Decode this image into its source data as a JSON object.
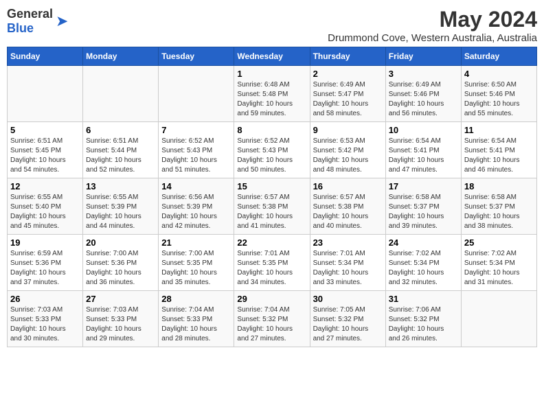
{
  "logo": {
    "general": "General",
    "blue": "Blue"
  },
  "title": "May 2024",
  "subtitle": "Drummond Cove, Western Australia, Australia",
  "days_of_week": [
    "Sunday",
    "Monday",
    "Tuesday",
    "Wednesday",
    "Thursday",
    "Friday",
    "Saturday"
  ],
  "weeks": [
    [
      {
        "day": "",
        "info": ""
      },
      {
        "day": "",
        "info": ""
      },
      {
        "day": "",
        "info": ""
      },
      {
        "day": "1",
        "info": "Sunrise: 6:48 AM\nSunset: 5:48 PM\nDaylight: 10 hours\nand 59 minutes."
      },
      {
        "day": "2",
        "info": "Sunrise: 6:49 AM\nSunset: 5:47 PM\nDaylight: 10 hours\nand 58 minutes."
      },
      {
        "day": "3",
        "info": "Sunrise: 6:49 AM\nSunset: 5:46 PM\nDaylight: 10 hours\nand 56 minutes."
      },
      {
        "day": "4",
        "info": "Sunrise: 6:50 AM\nSunset: 5:46 PM\nDaylight: 10 hours\nand 55 minutes."
      }
    ],
    [
      {
        "day": "5",
        "info": "Sunrise: 6:51 AM\nSunset: 5:45 PM\nDaylight: 10 hours\nand 54 minutes."
      },
      {
        "day": "6",
        "info": "Sunrise: 6:51 AM\nSunset: 5:44 PM\nDaylight: 10 hours\nand 52 minutes."
      },
      {
        "day": "7",
        "info": "Sunrise: 6:52 AM\nSunset: 5:43 PM\nDaylight: 10 hours\nand 51 minutes."
      },
      {
        "day": "8",
        "info": "Sunrise: 6:52 AM\nSunset: 5:43 PM\nDaylight: 10 hours\nand 50 minutes."
      },
      {
        "day": "9",
        "info": "Sunrise: 6:53 AM\nSunset: 5:42 PM\nDaylight: 10 hours\nand 48 minutes."
      },
      {
        "day": "10",
        "info": "Sunrise: 6:54 AM\nSunset: 5:41 PM\nDaylight: 10 hours\nand 47 minutes."
      },
      {
        "day": "11",
        "info": "Sunrise: 6:54 AM\nSunset: 5:41 PM\nDaylight: 10 hours\nand 46 minutes."
      }
    ],
    [
      {
        "day": "12",
        "info": "Sunrise: 6:55 AM\nSunset: 5:40 PM\nDaylight: 10 hours\nand 45 minutes."
      },
      {
        "day": "13",
        "info": "Sunrise: 6:55 AM\nSunset: 5:39 PM\nDaylight: 10 hours\nand 44 minutes."
      },
      {
        "day": "14",
        "info": "Sunrise: 6:56 AM\nSunset: 5:39 PM\nDaylight: 10 hours\nand 42 minutes."
      },
      {
        "day": "15",
        "info": "Sunrise: 6:57 AM\nSunset: 5:38 PM\nDaylight: 10 hours\nand 41 minutes."
      },
      {
        "day": "16",
        "info": "Sunrise: 6:57 AM\nSunset: 5:38 PM\nDaylight: 10 hours\nand 40 minutes."
      },
      {
        "day": "17",
        "info": "Sunrise: 6:58 AM\nSunset: 5:37 PM\nDaylight: 10 hours\nand 39 minutes."
      },
      {
        "day": "18",
        "info": "Sunrise: 6:58 AM\nSunset: 5:37 PM\nDaylight: 10 hours\nand 38 minutes."
      }
    ],
    [
      {
        "day": "19",
        "info": "Sunrise: 6:59 AM\nSunset: 5:36 PM\nDaylight: 10 hours\nand 37 minutes."
      },
      {
        "day": "20",
        "info": "Sunrise: 7:00 AM\nSunset: 5:36 PM\nDaylight: 10 hours\nand 36 minutes."
      },
      {
        "day": "21",
        "info": "Sunrise: 7:00 AM\nSunset: 5:35 PM\nDaylight: 10 hours\nand 35 minutes."
      },
      {
        "day": "22",
        "info": "Sunrise: 7:01 AM\nSunset: 5:35 PM\nDaylight: 10 hours\nand 34 minutes."
      },
      {
        "day": "23",
        "info": "Sunrise: 7:01 AM\nSunset: 5:34 PM\nDaylight: 10 hours\nand 33 minutes."
      },
      {
        "day": "24",
        "info": "Sunrise: 7:02 AM\nSunset: 5:34 PM\nDaylight: 10 hours\nand 32 minutes."
      },
      {
        "day": "25",
        "info": "Sunrise: 7:02 AM\nSunset: 5:34 PM\nDaylight: 10 hours\nand 31 minutes."
      }
    ],
    [
      {
        "day": "26",
        "info": "Sunrise: 7:03 AM\nSunset: 5:33 PM\nDaylight: 10 hours\nand 30 minutes."
      },
      {
        "day": "27",
        "info": "Sunrise: 7:03 AM\nSunset: 5:33 PM\nDaylight: 10 hours\nand 29 minutes."
      },
      {
        "day": "28",
        "info": "Sunrise: 7:04 AM\nSunset: 5:33 PM\nDaylight: 10 hours\nand 28 minutes."
      },
      {
        "day": "29",
        "info": "Sunrise: 7:04 AM\nSunset: 5:32 PM\nDaylight: 10 hours\nand 27 minutes."
      },
      {
        "day": "30",
        "info": "Sunrise: 7:05 AM\nSunset: 5:32 PM\nDaylight: 10 hours\nand 27 minutes."
      },
      {
        "day": "31",
        "info": "Sunrise: 7:06 AM\nSunset: 5:32 PM\nDaylight: 10 hours\nand 26 minutes."
      },
      {
        "day": "",
        "info": ""
      }
    ]
  ]
}
